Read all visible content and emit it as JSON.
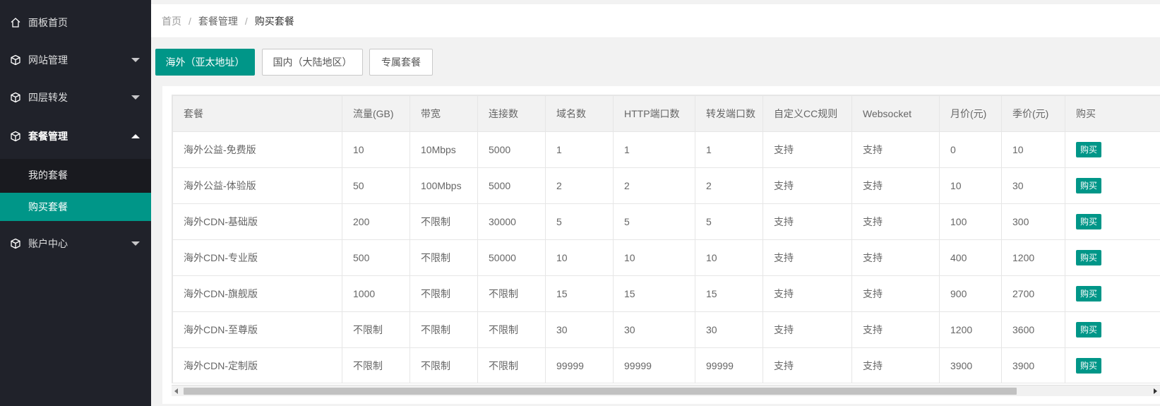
{
  "sidebar": {
    "items": [
      {
        "label": "面板首页",
        "icon": "home-icon"
      },
      {
        "label": "网站管理",
        "icon": "cube-icon"
      },
      {
        "label": "四层转发",
        "icon": "cube-icon"
      },
      {
        "label": "套餐管理",
        "icon": "cube-icon"
      },
      {
        "label": "账户中心",
        "icon": "cube-icon"
      }
    ],
    "submenu": [
      {
        "label": "我的套餐"
      },
      {
        "label": "购买套餐"
      }
    ]
  },
  "breadcrumb": [
    "首页",
    "套餐管理",
    "购买套餐"
  ],
  "tabs": [
    "海外（亚太地址）",
    "国内（大陆地区）",
    "专属套餐"
  ],
  "table": {
    "headers": [
      "套餐",
      "流量(GB)",
      "带宽",
      "连接数",
      "域名数",
      "HTTP端口数",
      "转发端口数",
      "自定义CC规则",
      "Websocket",
      "月价(元)",
      "季价(元)",
      "购买"
    ],
    "rows": [
      [
        "海外公益-免费版",
        "10",
        "10Mbps",
        "5000",
        "1",
        "1",
        "1",
        "支持",
        "支持",
        "0",
        "10",
        "购买"
      ],
      [
        "海外公益-体验版",
        "50",
        "100Mbps",
        "5000",
        "2",
        "2",
        "2",
        "支持",
        "支持",
        "10",
        "30",
        "购买"
      ],
      [
        "海外CDN-基础版",
        "200",
        "不限制",
        "30000",
        "5",
        "5",
        "5",
        "支持",
        "支持",
        "100",
        "300",
        "购买"
      ],
      [
        "海外CDN-专业版",
        "500",
        "不限制",
        "50000",
        "10",
        "10",
        "10",
        "支持",
        "支持",
        "400",
        "1200",
        "购买"
      ],
      [
        "海外CDN-旗舰版",
        "1000",
        "不限制",
        "不限制",
        "15",
        "15",
        "15",
        "支持",
        "支持",
        "900",
        "2700",
        "购买"
      ],
      [
        "海外CDN-至尊版",
        "不限制",
        "不限制",
        "不限制",
        "30",
        "30",
        "30",
        "支持",
        "支持",
        "1200",
        "3600",
        "购买"
      ],
      [
        "海外CDN-定制版",
        "不限制",
        "不限制",
        "不限制",
        "99999",
        "99999",
        "99999",
        "支持",
        "支持",
        "3900",
        "3900",
        "购买"
      ]
    ]
  },
  "colors": {
    "accent": "#009688",
    "sidebar_bg": "#20222a"
  }
}
